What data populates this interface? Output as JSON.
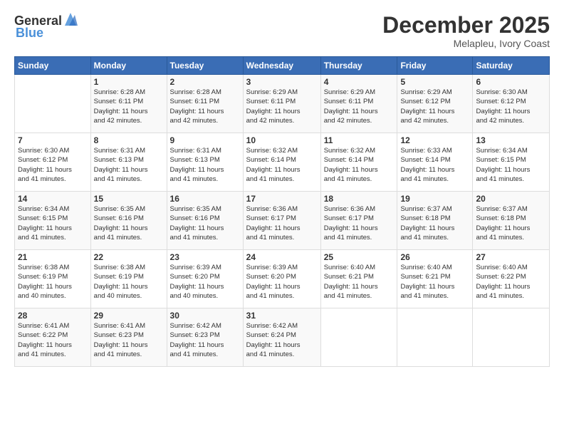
{
  "logo": {
    "text_general": "General",
    "text_blue": "Blue"
  },
  "header": {
    "month": "December 2025",
    "location": "Melapleu, Ivory Coast"
  },
  "days_of_week": [
    "Sunday",
    "Monday",
    "Tuesday",
    "Wednesday",
    "Thursday",
    "Friday",
    "Saturday"
  ],
  "weeks": [
    [
      {
        "day": "",
        "info": ""
      },
      {
        "day": "1",
        "info": "Sunrise: 6:28 AM\nSunset: 6:11 PM\nDaylight: 11 hours\nand 42 minutes."
      },
      {
        "day": "2",
        "info": "Sunrise: 6:28 AM\nSunset: 6:11 PM\nDaylight: 11 hours\nand 42 minutes."
      },
      {
        "day": "3",
        "info": "Sunrise: 6:29 AM\nSunset: 6:11 PM\nDaylight: 11 hours\nand 42 minutes."
      },
      {
        "day": "4",
        "info": "Sunrise: 6:29 AM\nSunset: 6:11 PM\nDaylight: 11 hours\nand 42 minutes."
      },
      {
        "day": "5",
        "info": "Sunrise: 6:29 AM\nSunset: 6:12 PM\nDaylight: 11 hours\nand 42 minutes."
      },
      {
        "day": "6",
        "info": "Sunrise: 6:30 AM\nSunset: 6:12 PM\nDaylight: 11 hours\nand 42 minutes."
      }
    ],
    [
      {
        "day": "7",
        "info": "Sunrise: 6:30 AM\nSunset: 6:12 PM\nDaylight: 11 hours\nand 41 minutes."
      },
      {
        "day": "8",
        "info": "Sunrise: 6:31 AM\nSunset: 6:13 PM\nDaylight: 11 hours\nand 41 minutes."
      },
      {
        "day": "9",
        "info": "Sunrise: 6:31 AM\nSunset: 6:13 PM\nDaylight: 11 hours\nand 41 minutes."
      },
      {
        "day": "10",
        "info": "Sunrise: 6:32 AM\nSunset: 6:14 PM\nDaylight: 11 hours\nand 41 minutes."
      },
      {
        "day": "11",
        "info": "Sunrise: 6:32 AM\nSunset: 6:14 PM\nDaylight: 11 hours\nand 41 minutes."
      },
      {
        "day": "12",
        "info": "Sunrise: 6:33 AM\nSunset: 6:14 PM\nDaylight: 11 hours\nand 41 minutes."
      },
      {
        "day": "13",
        "info": "Sunrise: 6:34 AM\nSunset: 6:15 PM\nDaylight: 11 hours\nand 41 minutes."
      }
    ],
    [
      {
        "day": "14",
        "info": "Sunrise: 6:34 AM\nSunset: 6:15 PM\nDaylight: 11 hours\nand 41 minutes."
      },
      {
        "day": "15",
        "info": "Sunrise: 6:35 AM\nSunset: 6:16 PM\nDaylight: 11 hours\nand 41 minutes."
      },
      {
        "day": "16",
        "info": "Sunrise: 6:35 AM\nSunset: 6:16 PM\nDaylight: 11 hours\nand 41 minutes."
      },
      {
        "day": "17",
        "info": "Sunrise: 6:36 AM\nSunset: 6:17 PM\nDaylight: 11 hours\nand 41 minutes."
      },
      {
        "day": "18",
        "info": "Sunrise: 6:36 AM\nSunset: 6:17 PM\nDaylight: 11 hours\nand 41 minutes."
      },
      {
        "day": "19",
        "info": "Sunrise: 6:37 AM\nSunset: 6:18 PM\nDaylight: 11 hours\nand 41 minutes."
      },
      {
        "day": "20",
        "info": "Sunrise: 6:37 AM\nSunset: 6:18 PM\nDaylight: 11 hours\nand 41 minutes."
      }
    ],
    [
      {
        "day": "21",
        "info": "Sunrise: 6:38 AM\nSunset: 6:19 PM\nDaylight: 11 hours\nand 40 minutes."
      },
      {
        "day": "22",
        "info": "Sunrise: 6:38 AM\nSunset: 6:19 PM\nDaylight: 11 hours\nand 40 minutes."
      },
      {
        "day": "23",
        "info": "Sunrise: 6:39 AM\nSunset: 6:20 PM\nDaylight: 11 hours\nand 40 minutes."
      },
      {
        "day": "24",
        "info": "Sunrise: 6:39 AM\nSunset: 6:20 PM\nDaylight: 11 hours\nand 41 minutes."
      },
      {
        "day": "25",
        "info": "Sunrise: 6:40 AM\nSunset: 6:21 PM\nDaylight: 11 hours\nand 41 minutes."
      },
      {
        "day": "26",
        "info": "Sunrise: 6:40 AM\nSunset: 6:21 PM\nDaylight: 11 hours\nand 41 minutes."
      },
      {
        "day": "27",
        "info": "Sunrise: 6:40 AM\nSunset: 6:22 PM\nDaylight: 11 hours\nand 41 minutes."
      }
    ],
    [
      {
        "day": "28",
        "info": "Sunrise: 6:41 AM\nSunset: 6:22 PM\nDaylight: 11 hours\nand 41 minutes."
      },
      {
        "day": "29",
        "info": "Sunrise: 6:41 AM\nSunset: 6:23 PM\nDaylight: 11 hours\nand 41 minutes."
      },
      {
        "day": "30",
        "info": "Sunrise: 6:42 AM\nSunset: 6:23 PM\nDaylight: 11 hours\nand 41 minutes."
      },
      {
        "day": "31",
        "info": "Sunrise: 6:42 AM\nSunset: 6:24 PM\nDaylight: 11 hours\nand 41 minutes."
      },
      {
        "day": "",
        "info": ""
      },
      {
        "day": "",
        "info": ""
      },
      {
        "day": "",
        "info": ""
      }
    ]
  ]
}
